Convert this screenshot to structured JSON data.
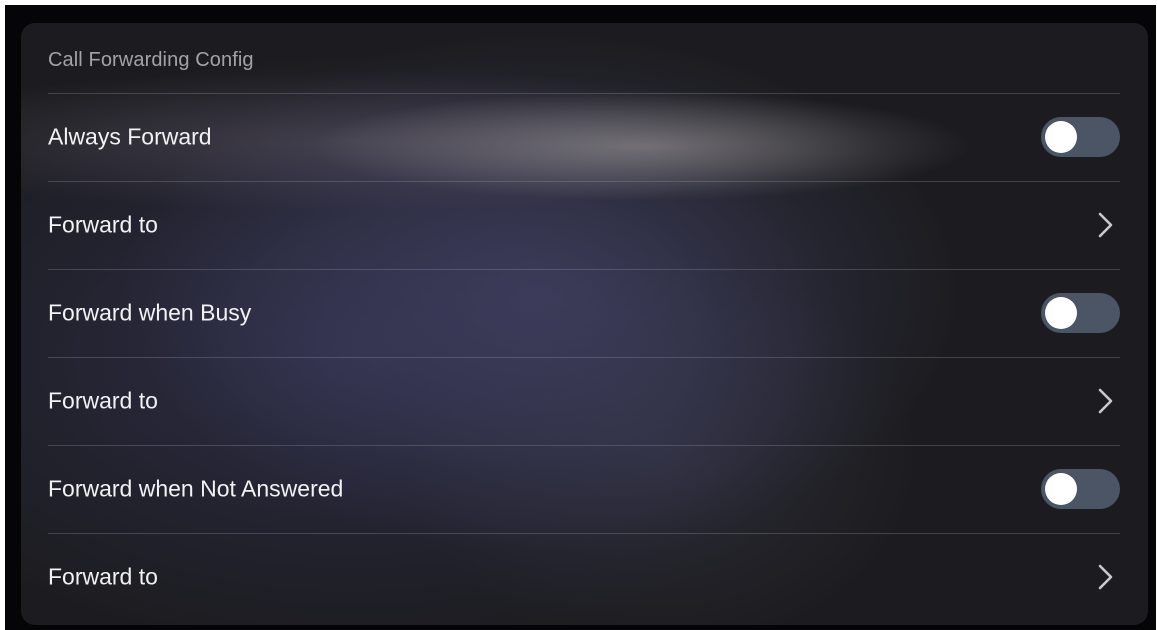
{
  "panel": {
    "title": "Call Forwarding Config"
  },
  "rows": [
    {
      "label": "Always Forward",
      "control": "toggle",
      "enabled": false
    },
    {
      "label": "Forward to",
      "control": "chevron-right-icon"
    },
    {
      "label": "Forward when Busy",
      "control": "toggle",
      "enabled": false
    },
    {
      "label": "Forward to",
      "control": "chevron-right-icon"
    },
    {
      "label": "Forward when Not Answered",
      "control": "toggle",
      "enabled": false
    },
    {
      "label": "Forward to",
      "control": "chevron-right-icon"
    }
  ],
  "colors": {
    "toggle_track_off": "#4b5566",
    "toggle_knob": "#ffffff",
    "text_primary": "#f2f2f4",
    "text_secondary": "#a2a2aa"
  }
}
